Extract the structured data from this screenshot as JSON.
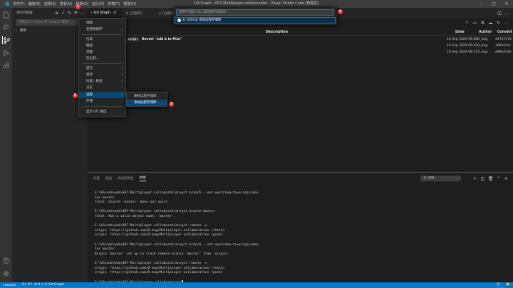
{
  "titlebar": {
    "menus": [
      "文件(F)",
      "编辑(E)",
      "选择(S)",
      "查看(V)",
      "转到(G)",
      "运行(R)",
      "终端(T)",
      "帮助(H)"
    ],
    "title": "Git Graph - 007-Multiplayer-collaboration - Visual Studio Code [管理员]"
  },
  "sidebar": {
    "header": "源代码管理",
    "search_placeholder": "消息(Ctrl+Enter 在\"master\"提交)",
    "changes_label": "更改"
  },
  "tabs": [
    {
      "label": "Git Graph",
      "active": true
    },
    {
      "label": "b (已删除)",
      "active": false
    },
    {
      "label": "a (已删除)",
      "active": false
    }
  ],
  "quick_input": {
    "placeholder": "提供存储库 URL 或选择存储库源。",
    "item": "从 GitHub 添加远程存储库"
  },
  "git_graph": {
    "columns": {
      "description": "Description",
      "date": "Date",
      "author": "Author",
      "commit": "Commit"
    },
    "commits": [
      {
        "badge1": "master",
        "badge2": "origin",
        "description": "Revert \"add b to M1n\"",
        "date": "16 Sep 2020 09:48",
        "author": "D_bog",
        "commit": "44747276"
      },
      {
        "badge1": "",
        "badge2": "",
        "description": "",
        "date": "16 Sep 2020 09:43",
        "author": "D_bog",
        "commit": "399934cc"
      },
      {
        "badge1": "",
        "badge2": "",
        "description": "",
        "date": "16 Sep 2020 08:57",
        "author": "D_bog",
        "commit": "e69ed19e"
      }
    ]
  },
  "context_menu": {
    "items": [
      {
        "label": "视图",
        "submenu": true
      },
      {
        "label": "查看和排序",
        "submenu": true
      },
      {
        "label": "拉取",
        "submenu": false
      },
      {
        "label": "推送",
        "submenu": false
      },
      {
        "label": "克隆",
        "submenu": false
      },
      {
        "label": "签出到...",
        "submenu": false
      },
      {
        "label": "提交",
        "submenu": true
      },
      {
        "label": "更改",
        "submenu": true
      },
      {
        "label": "拉取，推送",
        "submenu": true
      },
      {
        "label": "分支",
        "submenu": true
      },
      {
        "label": "远程",
        "submenu": true
      },
      {
        "label": "存储",
        "submenu": true
      },
      {
        "label": "显示 GIT 输出",
        "submenu": false
      }
    ],
    "submenu_items": [
      "删除远程存储库",
      "添加远程存储库..."
    ]
  },
  "markers": [
    "1",
    "2",
    "3",
    "4"
  ],
  "panel": {
    "tabs": [
      "问题",
      "输出",
      "调试控制台",
      "终端"
    ],
    "terminal_select": "1: cmd",
    "terminal_lines": [
      "E:\\VScode\\web\\007-Multiplayer-collaboration>git branch --set-upstream-to=origin/mas",
      "ter master",
      "fatal: branch 'master' does not exist",
      "",
      "E:\\VScode\\web\\007-Multiplayer-collaboration>git branch master",
      "fatal: Not a valid object name: 'master'.",
      "",
      "E:\\VScode\\web\\007-Multiplayer-collaboration>git remote -v",
      "origin  https://github.com/D-bog/Multiplayer-collaboration (fetch)",
      "origin  https://github.com/D-bog/Multiplayer-collaboration (push)",
      "",
      "E:\\VScode\\web\\007-Multiplayer-collaboration>git branch --set-upstream-to=origin/mas",
      "ter master",
      "Branch 'master' set up to track remote branch 'master' from 'origin'.",
      "",
      "E:\\VScode\\web\\007-Multiplayer-collaboration>git remote -v",
      "origin  https://github.com/D-bog/Multiplayer-collaboration (fetch)",
      "origin  https://github.com/D-bog/Multiplayer-collaboration (push)",
      "",
      "E:\\VScode\\web\\007-Multiplayer-collaboration>"
    ]
  },
  "statusbar": {
    "branch": "master",
    "sync": "0↓ 0↑",
    "problems": "⊗ 0 ⚠ 0",
    "gitgraph": "Git Graph"
  },
  "colors": {
    "accent": "#007acc",
    "highlight": "#094771",
    "marker": "#e5383b"
  }
}
